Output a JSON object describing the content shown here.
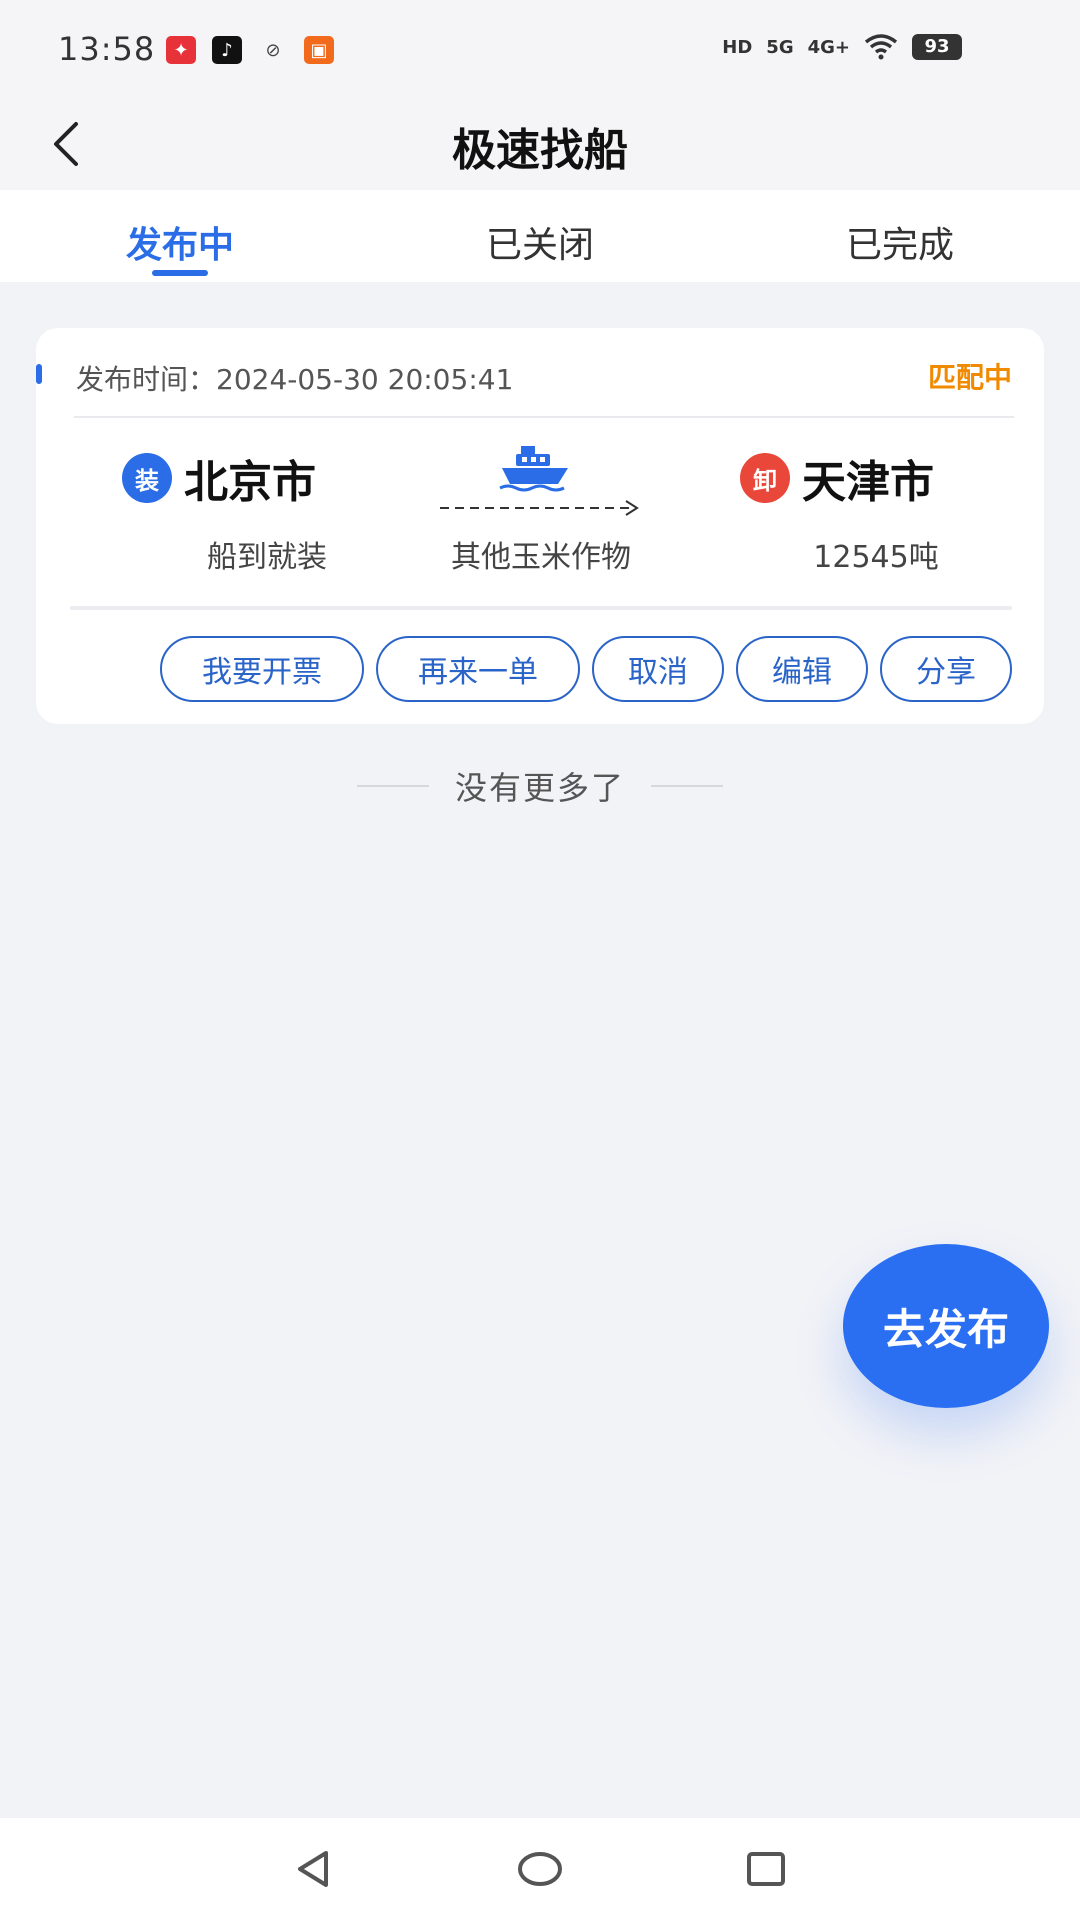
{
  "status_bar": {
    "time": "13:58",
    "battery": "93",
    "signal_labels": [
      "HD",
      "5G",
      "4G+"
    ],
    "notification_icons": [
      "app-red-icon",
      "tiktok-icon",
      "leaf-app-icon",
      "orange-app-icon"
    ]
  },
  "header": {
    "title": "极速找船"
  },
  "tabs": [
    {
      "label": "发布中",
      "active": true
    },
    {
      "label": "已关闭",
      "active": false
    },
    {
      "label": "已完成",
      "active": false
    }
  ],
  "card": {
    "publish_time": "发布时间：2024-05-30 20:05:41",
    "status": "匹配中",
    "load": {
      "badge": "装",
      "city": "北京市",
      "sub": "船到就装"
    },
    "cargo": "其他玉米作物",
    "unload": {
      "badge": "卸",
      "city": "天津市",
      "sub": "12545吨"
    },
    "actions": [
      "我要开票",
      "再来一单",
      "取消",
      "编辑",
      "分享"
    ]
  },
  "list_end_text": "没有更多了",
  "fab_label": "去发布",
  "colors": {
    "primary": "#2a6de6",
    "status_orange": "#f08a00",
    "load_badge": "#2a6de6",
    "unload_badge": "#e9473a"
  }
}
